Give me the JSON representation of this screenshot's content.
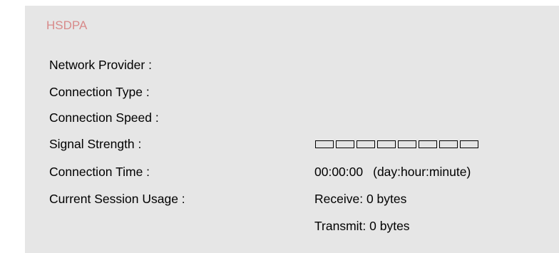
{
  "section": {
    "title": "HSDPA"
  },
  "labels": {
    "network_provider": "Network Provider :",
    "connection_type": "Connection Type :",
    "connection_speed": "Connection Speed :",
    "signal_strength": "Signal Strength :",
    "connection_time": "Connection Time :",
    "session_usage": "Current Session Usage :"
  },
  "values": {
    "network_provider": "",
    "connection_type": "",
    "connection_speed": "",
    "signal_strength_level": 0,
    "signal_strength_segments": 8,
    "connection_time": "00:00:00",
    "connection_time_unit": "(day:hour:minute)",
    "receive": "Receive: 0 bytes",
    "transmit": "Transmit: 0 bytes"
  },
  "colors": {
    "title": "#d88a8a",
    "panel_background": "#e6e6e6",
    "signal_on": "#2f9a2f",
    "signal_off": "#e4e4e4"
  }
}
